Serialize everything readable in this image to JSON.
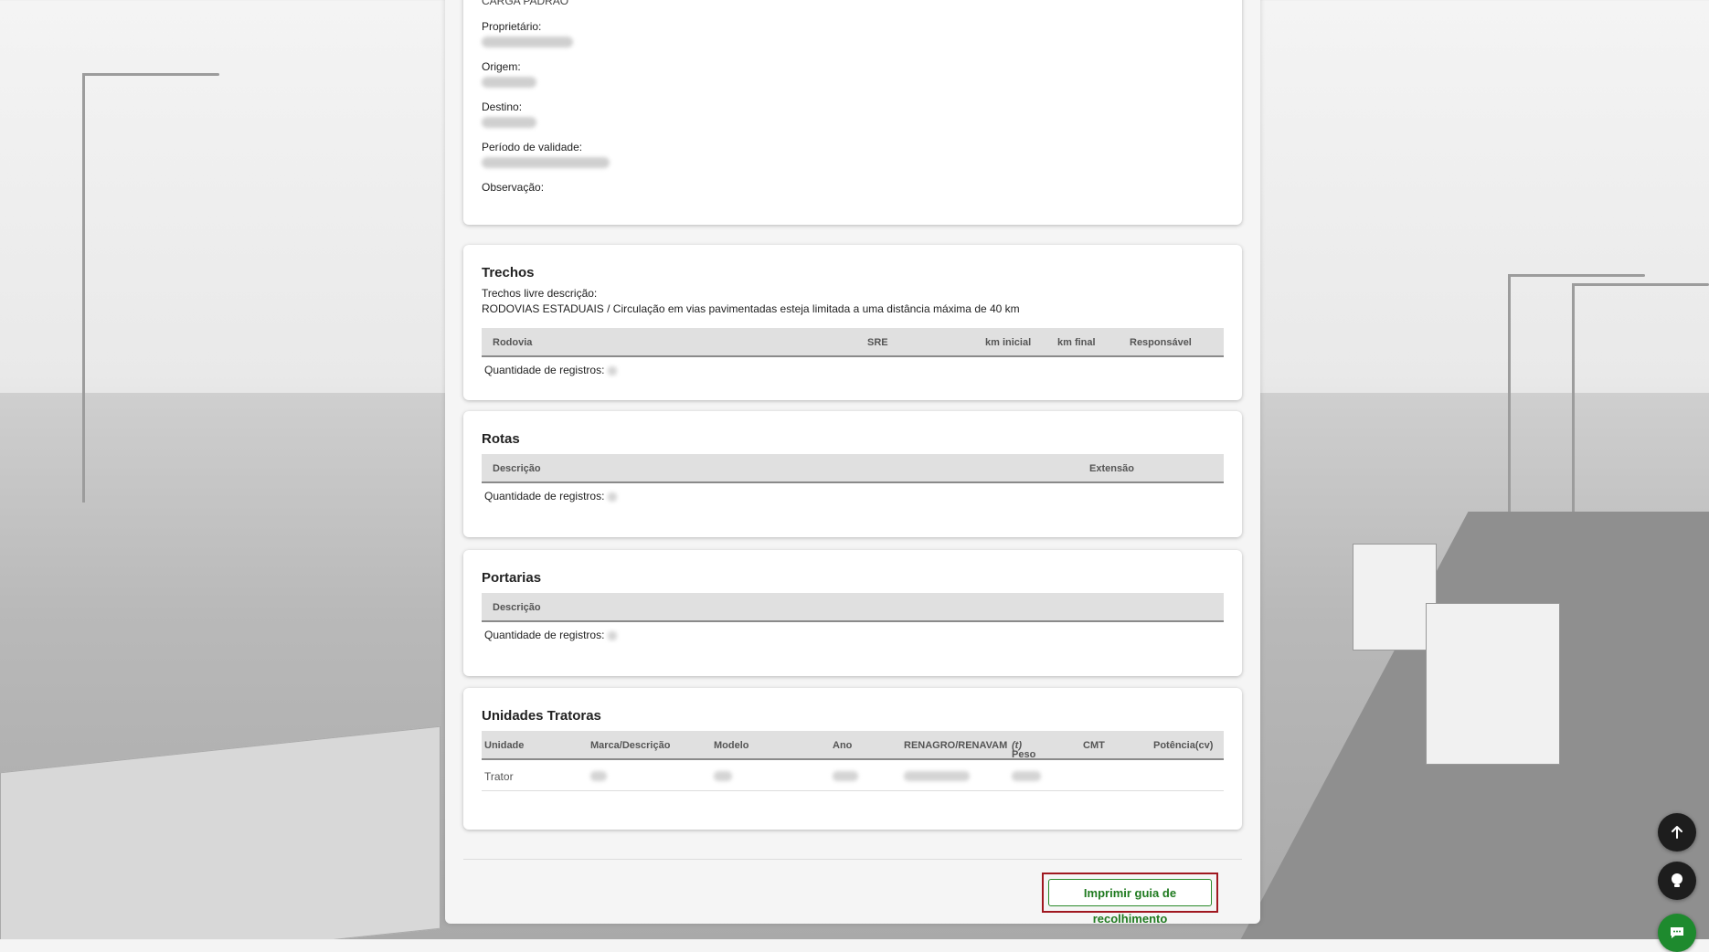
{
  "details": {
    "top_value": "CARGA PADRÃO",
    "owner_label": "Proprietário:",
    "origin_label": "Origem:",
    "destination_label": "Destino:",
    "validity_label": "Período de validade:",
    "observation_label": "Observação:"
  },
  "trechos": {
    "title": "Trechos",
    "free_desc_label": "Trechos livre descrição:",
    "free_desc_text": "RODOVIAS ESTADUAIS / Circulação em vias pavimentadas esteja limitada a uma distância máxima de 40 km",
    "columns": [
      "Rodovia",
      "SRE",
      "km inicial",
      "km final",
      "Responsável"
    ],
    "count_label": "Quantidade de registros:"
  },
  "rotas": {
    "title": "Rotas",
    "columns": [
      "Descrição",
      "Extensão"
    ],
    "count_label": "Quantidade de registros:"
  },
  "portarias": {
    "title": "Portarias",
    "columns": [
      "Descrição"
    ],
    "count_label": "Quantidade de registros:"
  },
  "unidades": {
    "title": "Unidades Tratoras",
    "columns": [
      "Unidade",
      "Marca/Descrição",
      "Modelo",
      "Ano",
      "RENAGRO/RENAVAM",
      "Peso",
      "(t)",
      "CMT",
      "Potência(cv)"
    ],
    "rows": [
      {
        "unidade": "Trator"
      }
    ]
  },
  "actions": {
    "print_label": "Imprimir guia de recolhimento"
  },
  "fabs": {
    "top_icon": "arrow-up-icon",
    "tip_icon": "lightbulb-icon",
    "chat_icon": "chat-icon"
  }
}
